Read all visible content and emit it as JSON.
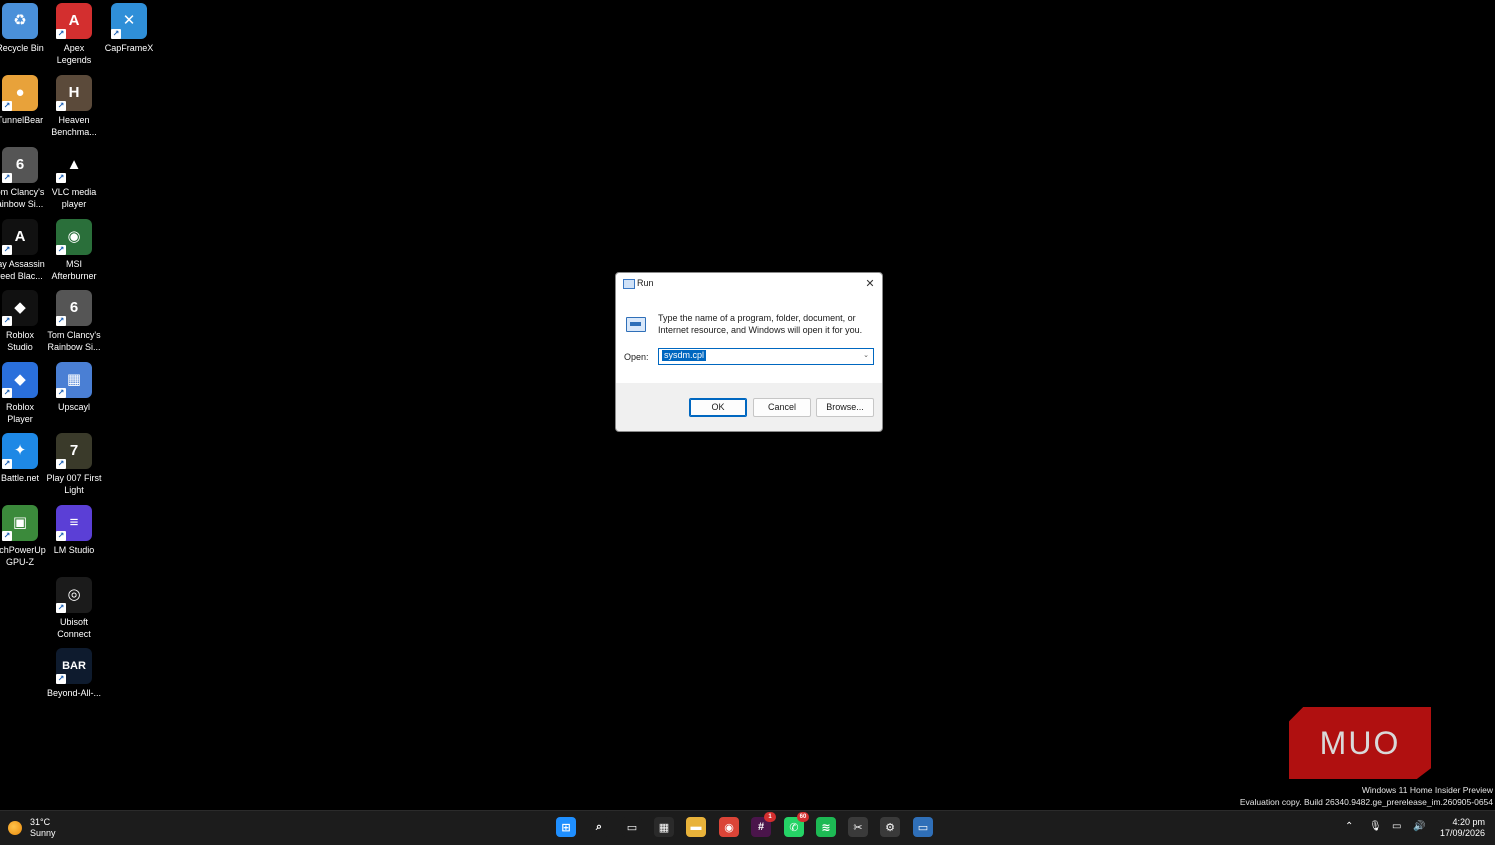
{
  "desktop_icons": [
    {
      "label": "Recycle Bin",
      "icon": "recycle-bin-icon",
      "color": "#4a90d9",
      "glyph": "♻",
      "shortcut": false
    },
    {
      "label": "Apex\nLegends",
      "icon": "apex-legends-icon",
      "color": "#d32f2f",
      "glyph": "A",
      "shortcut": true
    },
    {
      "label": "CapFrameX",
      "icon": "capframex-icon",
      "color": "#2f8fd8",
      "glyph": "✕",
      "shortcut": true
    },
    {
      "label": "TunnelBear",
      "icon": "tunnelbear-icon",
      "color": "#e8a23a",
      "glyph": "●",
      "shortcut": true
    },
    {
      "label": "Heaven\nBenchma...",
      "icon": "heaven-benchmark-icon",
      "color": "#5b4a3a",
      "glyph": "H",
      "shortcut": true
    },
    {
      "label": "om Clancy's\nainbow Si...",
      "icon": "rainbow-six-icon",
      "color": "#555555",
      "glyph": "6",
      "shortcut": true
    },
    {
      "label": "VLC media\nplayer",
      "icon": "vlc-icon",
      "color": "#000000",
      "glyph": "▲",
      "shortcut": true
    },
    {
      "label": "lay Assassin\nreed Blac...",
      "icon": "assassins-creed-icon",
      "color": "#111111",
      "glyph": "A",
      "shortcut": true
    },
    {
      "label": "MSI\nAfterburner",
      "icon": "msi-afterburner-icon",
      "color": "#2a6f3a",
      "glyph": "◉",
      "shortcut": true
    },
    {
      "label": "Roblox\nStudio",
      "icon": "roblox-studio-icon",
      "color": "#111111",
      "glyph": "◆",
      "shortcut": true
    },
    {
      "label": "Tom Clancy's\nRainbow Si...",
      "icon": "rainbow-six-2-icon",
      "color": "#555555",
      "glyph": "6",
      "shortcut": true
    },
    {
      "label": "Roblox\nPlayer",
      "icon": "roblox-player-icon",
      "color": "#2a6fdb",
      "glyph": "◆",
      "shortcut": true
    },
    {
      "label": "Upscayl",
      "icon": "upscayl-icon",
      "color": "#4a7fd4",
      "glyph": "▦",
      "shortcut": true
    },
    {
      "label": "Battle.net",
      "icon": "battlenet-icon",
      "color": "#1e88e5",
      "glyph": "✦",
      "shortcut": true
    },
    {
      "label": "Play 007 First\nLight",
      "icon": "007-first-light-icon",
      "color": "#3a3a2a",
      "glyph": "7",
      "shortcut": true
    },
    {
      "label": "echPowerUp\nGPU-Z",
      "icon": "gpu-z-icon",
      "color": "#3b8a3b",
      "glyph": "▣",
      "shortcut": true
    },
    {
      "label": "LM Studio",
      "icon": "lm-studio-icon",
      "color": "#5b3fd6",
      "glyph": "≡",
      "shortcut": true
    },
    {
      "label": "Ubisoft\nConnect",
      "icon": "ubisoft-connect-icon",
      "color": "#1b1b1b",
      "glyph": "◎",
      "shortcut": true
    },
    {
      "label": "Beyond-All-...",
      "icon": "beyond-all-reason-icon",
      "color": "#0e1b2e",
      "glyph": "BAR",
      "shortcut": true
    }
  ],
  "run_dialog": {
    "title": "Run",
    "close_glyph": "✕",
    "description": "Type the name of a program, folder, document, or Internet resource, and Windows will open it for you.",
    "open_label": "Open:",
    "input_value": "sysdm.cpl",
    "dropdown_glyph": "⌄",
    "ok_label": "OK",
    "cancel_label": "Cancel",
    "browse_label": "Browse..."
  },
  "watermark": {
    "line1": "Windows 11 Home Insider Preview",
    "line2": "Evaluation copy. Build 26340.9482.ge_prerelease_im.260905-0654"
  },
  "logo_text": "MUO",
  "taskbar": {
    "weather_temp": "31°C",
    "weather_desc": "Sunny",
    "apps": [
      {
        "name": "start-icon",
        "color": "#1f8fff",
        "glyph": "⊞",
        "badge": ""
      },
      {
        "name": "search-icon",
        "color": "#1c1c1c",
        "glyph": "⌕",
        "badge": ""
      },
      {
        "name": "task-view-icon",
        "color": "#1c1c1c",
        "glyph": "▭",
        "badge": ""
      },
      {
        "name": "microsoft-store-icon",
        "color": "#2a2a2a",
        "glyph": "▦",
        "badge": ""
      },
      {
        "name": "file-explorer-icon",
        "color": "#e8b23a",
        "glyph": "▬",
        "badge": ""
      },
      {
        "name": "chrome-icon",
        "color": "#db4437",
        "glyph": "◉",
        "badge": ""
      },
      {
        "name": "slack-icon",
        "color": "#4a154b",
        "glyph": "#",
        "badge": "1"
      },
      {
        "name": "whatsapp-icon",
        "color": "#25d366",
        "glyph": "✆",
        "badge": "60"
      },
      {
        "name": "spotify-icon",
        "color": "#1db954",
        "glyph": "≋",
        "badge": ""
      },
      {
        "name": "snipping-tool-icon",
        "color": "#3a3a3a",
        "glyph": "✂",
        "badge": ""
      },
      {
        "name": "settings-icon",
        "color": "#3a3a3a",
        "glyph": "⚙",
        "badge": ""
      },
      {
        "name": "run-taskbar-icon",
        "color": "#2f6fb8",
        "glyph": "▭",
        "badge": ""
      }
    ],
    "tray": [
      {
        "name": "chevron-up-icon",
        "glyph": "⌃"
      },
      {
        "name": "microphone-icon",
        "glyph": "🎙"
      },
      {
        "name": "network-icon",
        "glyph": "▭"
      },
      {
        "name": "volume-icon",
        "glyph": "🔊"
      }
    ],
    "time": "4:20 pm",
    "date": "17/09/2026"
  }
}
